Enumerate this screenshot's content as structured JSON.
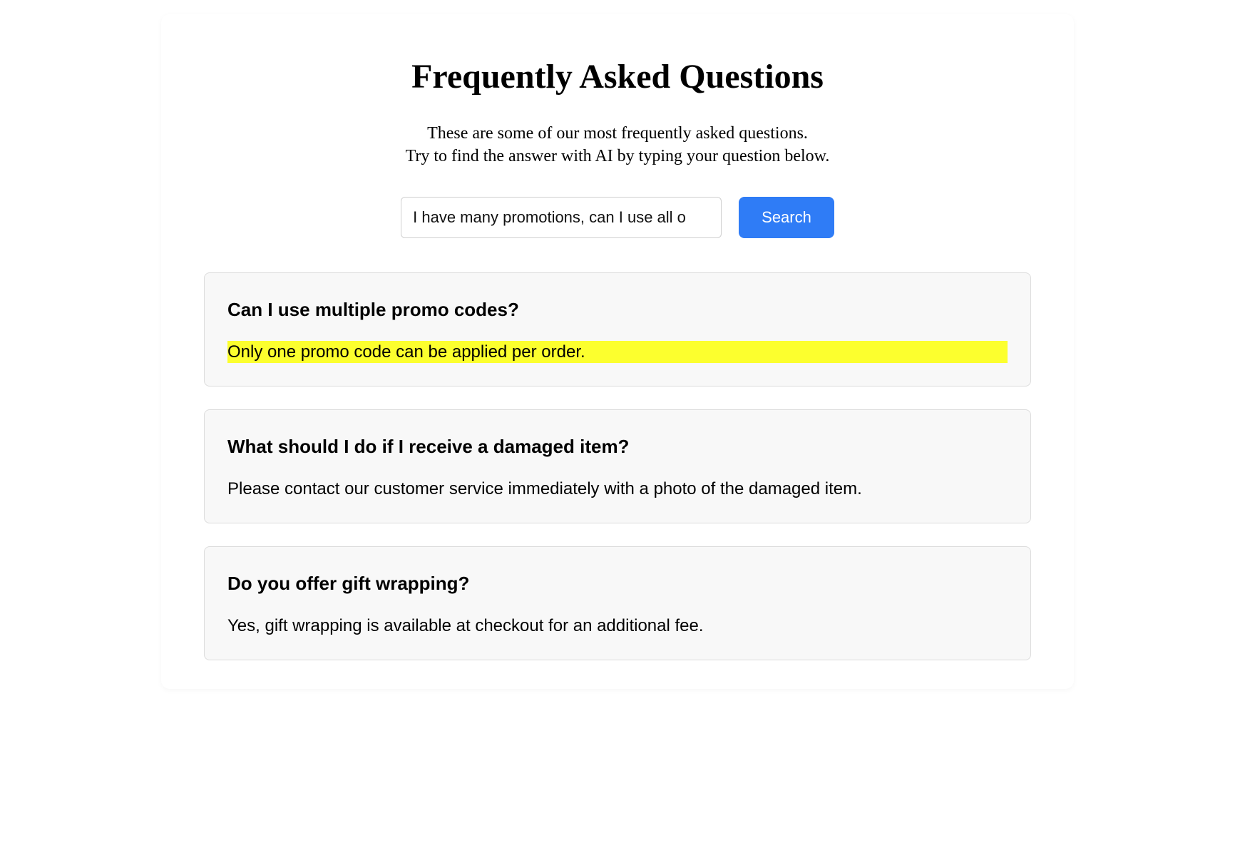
{
  "header": {
    "title": "Frequently Asked Questions",
    "subtitle_line1": "These are some of our most frequently asked questions.",
    "subtitle_line2": "Try to find the answer with AI by typing your question below."
  },
  "search": {
    "value": "I have many promotions, can I use all o",
    "button_label": "Search"
  },
  "faqs": [
    {
      "question": "Can I use multiple promo codes?",
      "answer": "Only one promo code can be applied per order.",
      "highlighted": true
    },
    {
      "question": "What should I do if I receive a damaged item?",
      "answer": "Please contact our customer service immediately with a photo of the damaged item.",
      "highlighted": false
    },
    {
      "question": "Do you offer gift wrapping?",
      "answer": "Yes, gift wrapping is available at checkout for an additional fee.",
      "highlighted": false
    }
  ]
}
